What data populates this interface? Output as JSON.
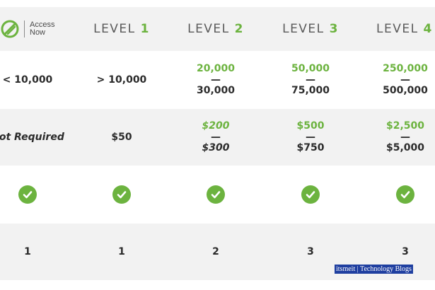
{
  "header": {
    "brand_line1": "Access",
    "brand_line2": "Now",
    "levels": [
      {
        "word": "LEVEL",
        "num": "1"
      },
      {
        "word": "LEVEL",
        "num": "2"
      },
      {
        "word": "LEVEL",
        "num": "3"
      },
      {
        "word": "LEVEL",
        "num": "4"
      }
    ]
  },
  "rows": {
    "range": [
      "< 10,000",
      "> 10,000",
      {
        "top": "20,000",
        "dash": "—",
        "bottom": "30,000"
      },
      {
        "top": "50,000",
        "dash": "—",
        "bottom": "75,000"
      },
      {
        "top": "250,000",
        "dash": "—",
        "bottom": "500,000"
      }
    ],
    "fee": [
      "Not Required",
      "$50",
      {
        "top": "$200",
        "dash": "—",
        "bottom": "$300"
      },
      {
        "top": "$500",
        "dash": "—",
        "bottom": "$750"
      },
      {
        "top": "$2,500",
        "dash": "—",
        "bottom": "$5,000"
      }
    ],
    "included": [
      "check-icon",
      "check-icon",
      "check-icon",
      "check-icon",
      "check-icon"
    ],
    "count": [
      "1",
      "1",
      "2",
      "3",
      "3"
    ]
  },
  "colors": {
    "accent": "#6cb33f",
    "stripe": "#f2f2f2",
    "text": "#2b2b2b"
  },
  "watermark": "itsmeit | Technology Blogs"
}
